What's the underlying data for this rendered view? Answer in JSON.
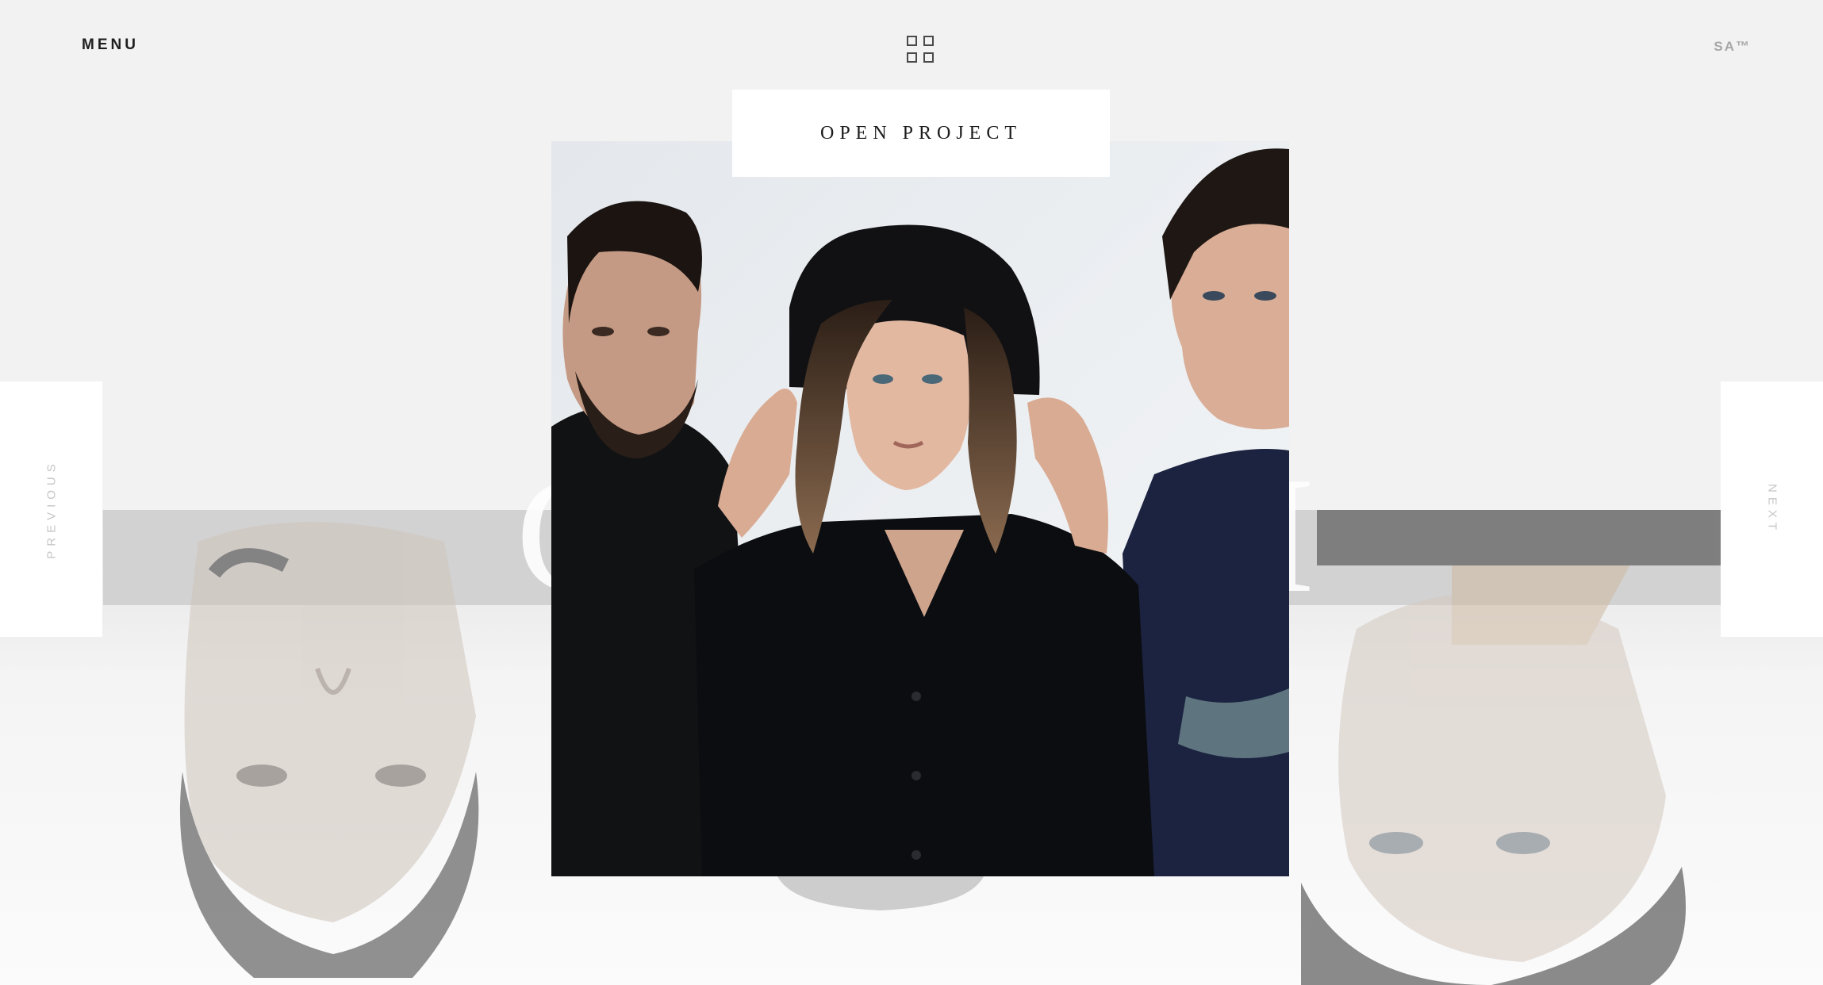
{
  "header": {
    "menu_label": "MENU",
    "grid_icon": "grid-view-icon",
    "brand": "SA™"
  },
  "hero": {
    "open_project_label": "OPEN PROJECT"
  },
  "nav": {
    "previous_label": "PREVIOUS",
    "next_label": "NEXT"
  },
  "colors": {
    "background": "#f2f2f2",
    "panel": "#ffffff",
    "text_dark": "#1e1e1e",
    "text_muted": "#c6c6c6"
  }
}
